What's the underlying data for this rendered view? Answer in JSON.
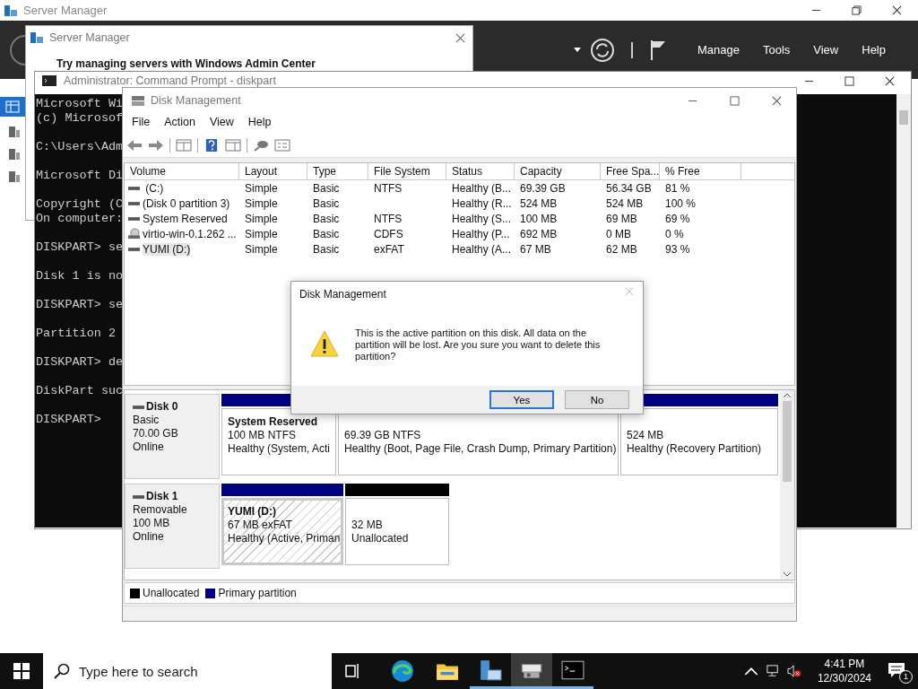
{
  "server_manager": {
    "title": "Server Manager",
    "menu": [
      "Manage",
      "Tools",
      "View",
      "Help"
    ]
  },
  "popup": {
    "title": "Server Manager",
    "heading": "Try managing servers with Windows Admin Center"
  },
  "command_prompt": {
    "title": "Administrator: Command Prompt - diskpart",
    "paragraphs": [
      [
        "Microsoft Wi",
        "(c) Microsof"
      ],
      [
        "C:\\Users\\Adm"
      ],
      [
        "Microsoft Di"
      ],
      [
        "Copyright (C",
        "On computer:"
      ],
      [
        "DISKPART> se"
      ],
      [
        "Disk 1 is no"
      ],
      [
        "DISKPART> se"
      ],
      [
        "Partition 2"
      ],
      [
        "DISKPART> de"
      ],
      [
        "DiskPart suc"
      ],
      [
        "DISKPART>"
      ]
    ]
  },
  "disk_management": {
    "title": "Disk Management",
    "menu": [
      "File",
      "Action",
      "View",
      "Help"
    ],
    "table": {
      "columns": [
        "Volume",
        "Layout",
        "Type",
        "File System",
        "Status",
        "Capacity",
        "Free Spa...",
        "% Free"
      ],
      "rows": [
        {
          "kind": "disk",
          "selected": false,
          "cells": [
            " (C:)",
            "Simple",
            "Basic",
            "NTFS",
            "Healthy (B...",
            "69.39 GB",
            "56.34 GB",
            "81 %"
          ]
        },
        {
          "kind": "disk",
          "selected": false,
          "cells": [
            "(Disk 0 partition 3)",
            "Simple",
            "Basic",
            "",
            "Healthy (R...",
            "524 MB",
            "524 MB",
            "100 %"
          ]
        },
        {
          "kind": "disk",
          "selected": false,
          "cells": [
            "System Reserved",
            "Simple",
            "Basic",
            "NTFS",
            "Healthy (S...",
            "100 MB",
            "69 MB",
            "69 %"
          ]
        },
        {
          "kind": "cd",
          "selected": false,
          "cells": [
            "virtio-win-0.1.262 ...",
            "Simple",
            "Basic",
            "CDFS",
            "Healthy (P...",
            "692 MB",
            "0 MB",
            "0 %"
          ]
        },
        {
          "kind": "disk",
          "selected": true,
          "cells": [
            "YUMI (D:)",
            "Simple",
            "Basic",
            "exFAT",
            "Healthy (A...",
            "67 MB",
            "62 MB",
            "93 %"
          ]
        }
      ]
    },
    "disks": [
      {
        "name": "Disk 0",
        "type": "Basic",
        "size": "70.00 GB",
        "status": "Online",
        "partitions": [
          {
            "kind": "primary",
            "selected": false,
            "name": "System Reserved",
            "size": "100 MB NTFS",
            "status": "Healthy (System, Acti"
          },
          {
            "selected": false,
            "size": "69.39 GB NTFS",
            "status": "Healthy (Boot, Page File, Crash Dump, Primary Partition)"
          },
          {
            "kind": "primary",
            "selected": false,
            "size": "524 MB",
            "status": "Healthy (Recovery Partition)"
          }
        ]
      },
      {
        "name": "Disk 1",
        "type": "Removable",
        "size": "100 MB",
        "status": "Online",
        "partitions": [
          {
            "kind": "primary",
            "selected": true,
            "name": "YUMI  (D:)",
            "size": "67 MB exFAT",
            "status": "Healthy (Active, Priman"
          },
          {
            "kind": "unallocated",
            "selected": false,
            "size": "32 MB",
            "status": "Unallocated"
          }
        ]
      }
    ],
    "legend": [
      {
        "label": "Unallocated",
        "color": "#000000"
      },
      {
        "label": "Primary partition",
        "color": "#000080"
      }
    ]
  },
  "dialog": {
    "title": "Disk Management",
    "message": "This is the active partition on this disk. All data on the partition will be lost. Are you sure you want to delete this partition?",
    "buttons": [
      {
        "label": "Yes",
        "selected": true
      },
      {
        "label": "No",
        "selected": false
      }
    ]
  },
  "taskbar": {
    "search": {
      "placeholder": "Type here to search"
    },
    "time": "4:41 PM",
    "date": "12/30/2024",
    "notifications": "1"
  }
}
